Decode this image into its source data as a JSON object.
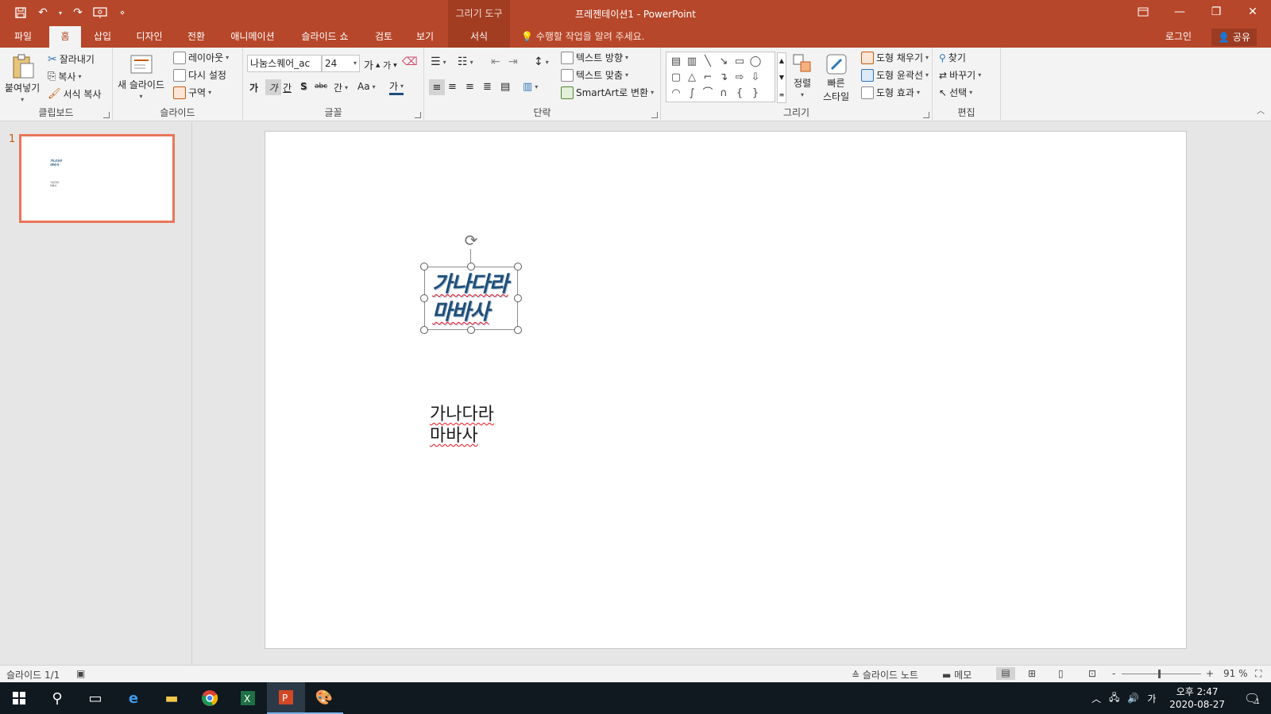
{
  "window": {
    "title": "프레젠테이션1  -  PowerPoint",
    "context_tab_group": "그리기 도구"
  },
  "tabs": {
    "file": "파일",
    "home": "홈",
    "insert": "삽입",
    "design": "디자인",
    "transitions": "전환",
    "animations": "애니메이션",
    "slideshow": "슬라이드 쇼",
    "review": "검토",
    "view": "보기",
    "format": "서식",
    "tellme": "수행할 작업을 알려 주세요.",
    "login": "로그인",
    "share": "공유"
  },
  "ribbon": {
    "clipboard": {
      "label": "클립보드",
      "paste": "붙여넣기",
      "cut": "잘라내기",
      "copy": "복사",
      "format_painter": "서식 복사"
    },
    "slides": {
      "label": "슬라이드",
      "new_slide": "새 슬라이드",
      "layout": "레이아웃",
      "reset": "다시 설정",
      "section": "구역"
    },
    "font": {
      "label": "글꼴",
      "font_name": "나눔스퀘어_ac",
      "font_size": "24",
      "grow": "가",
      "shrink": "가",
      "bold": "가",
      "italic": "가",
      "underline": "간",
      "strike_s": "S",
      "strike": "abc",
      "spacing": "간",
      "case": "Aa",
      "color": "가"
    },
    "paragraph": {
      "label": "단락",
      "text_direction": "텍스트 방향",
      "text_align": "텍스트 맞춤",
      "smartart": "SmartArt로 변환"
    },
    "drawing": {
      "label": "그리기",
      "arrange": "정렬",
      "quick_styles_1": "빠른",
      "quick_styles_2": "스타일",
      "shape_fill": "도형 채우기",
      "shape_outline": "도형 윤곽선",
      "shape_effects": "도형 효과"
    },
    "editing": {
      "label": "편집",
      "find": "찾기",
      "replace": "바꾸기",
      "select": "선택"
    }
  },
  "thumbnails": {
    "slide_number": "1"
  },
  "slide": {
    "textbox1_line1": "가나다라",
    "textbox1_line2": "마바사",
    "textbox2_line1": "가나다라",
    "textbox2_line2": "마바사"
  },
  "status": {
    "slide_counter": "슬라이드 1/1",
    "notes": "슬라이드 노트",
    "comments": "메모",
    "zoom_minus": "-",
    "zoom_plus": "+",
    "zoom": "91 %"
  },
  "taskbar": {
    "ime": "가",
    "time": "오후 2:47",
    "date": "2020-08-27",
    "notifications": "1"
  },
  "colors": {
    "accent": "#b7472a",
    "title_text": "#1f4e79",
    "selected_thumb_border": "#e8765a"
  }
}
